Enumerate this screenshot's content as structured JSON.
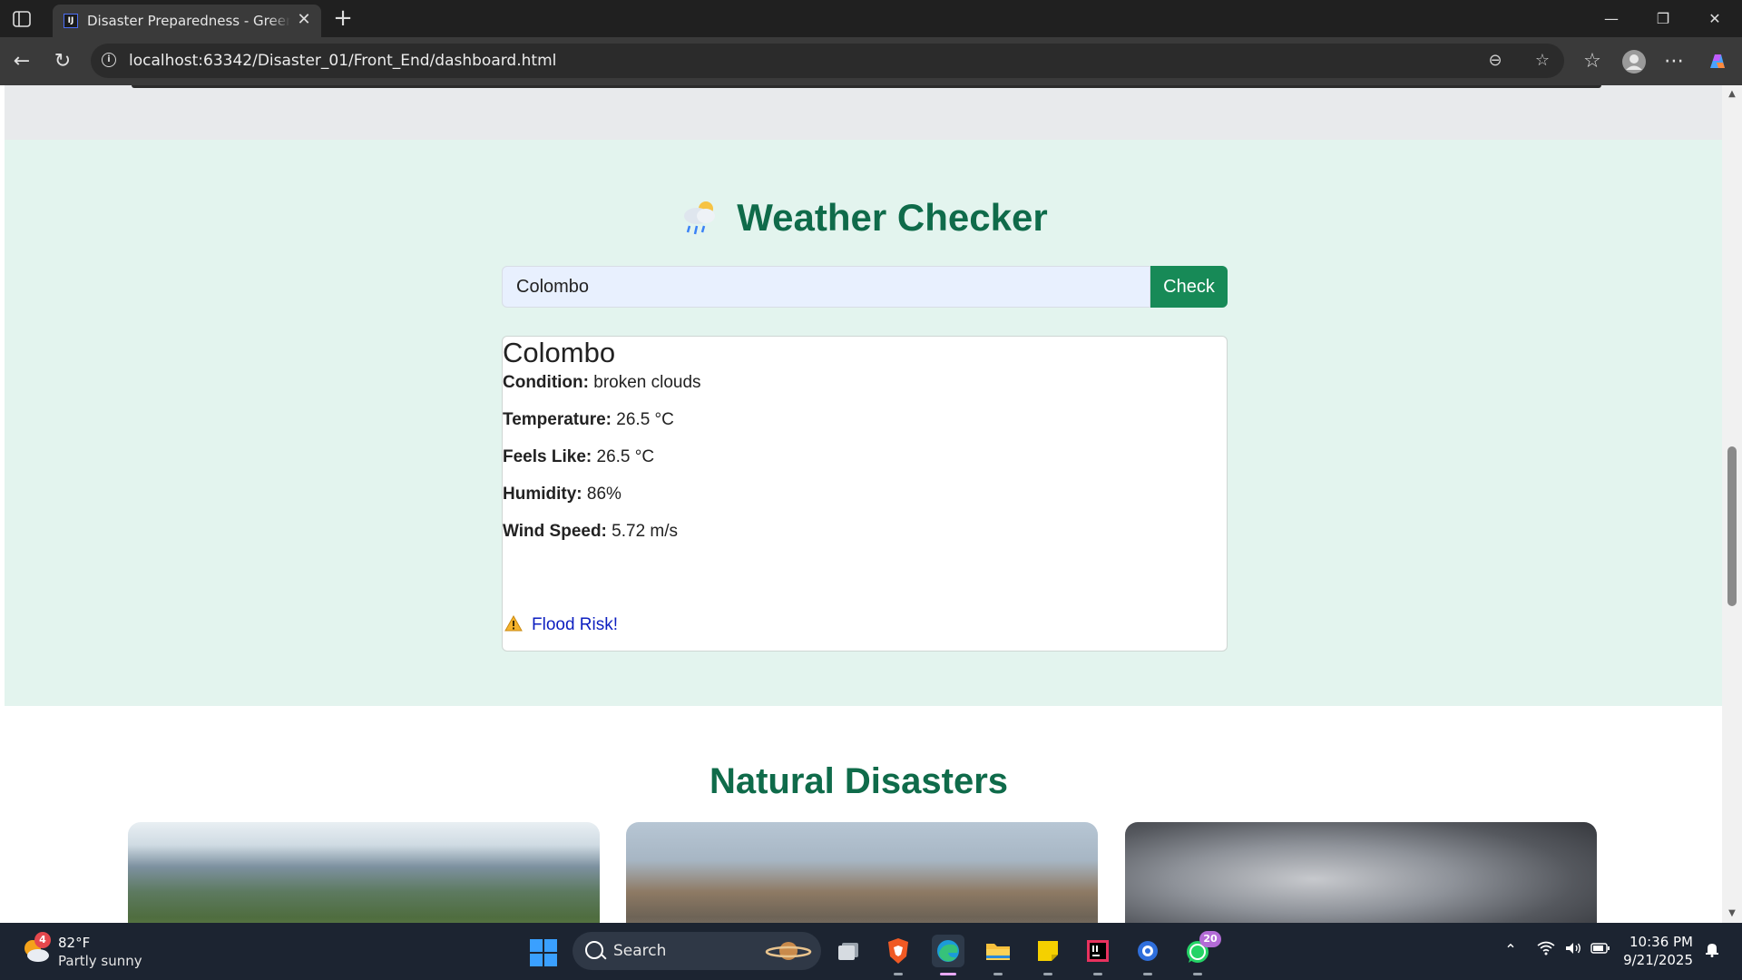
{
  "browser": {
    "tab_title": "Disaster Preparedness - Green Th",
    "url": "localhost:63342/Disaster_01/Front_End/dashboard.html"
  },
  "weather_checker": {
    "title": "Weather Checker",
    "input_value": "Colombo",
    "check_label": "Check",
    "result": {
      "city": "Colombo",
      "rows": [
        {
          "label": "Condition:",
          "value": "broken clouds"
        },
        {
          "label": "Temperature:",
          "value": "26.5 °C"
        },
        {
          "label": "Feels Like:",
          "value": "26.5 °C"
        },
        {
          "label": "Humidity:",
          "value": "86%"
        },
        {
          "label": "Wind Speed:",
          "value": "5.72 m/s"
        }
      ],
      "warning": "Flood Risk!"
    }
  },
  "natural_disasters": {
    "title": "Natural Disasters",
    "cards": [
      {
        "icon": "landslide-landscape-image"
      },
      {
        "icon": "earthquake-ruins-image"
      },
      {
        "icon": "storm-clouds-image"
      }
    ]
  },
  "taskbar": {
    "weather_temp": "82°F",
    "weather_desc": "Partly sunny",
    "weather_badge": "4",
    "search_label": "Search",
    "whatsapp_badge": "20",
    "time": "10:36 PM",
    "date": "9/21/2025"
  },
  "colors": {
    "accent_green": "#0f6b4a",
    "button_green": "#178a57",
    "section_bg": "#e3f4ee",
    "warning_link": "#0d1fc0"
  }
}
